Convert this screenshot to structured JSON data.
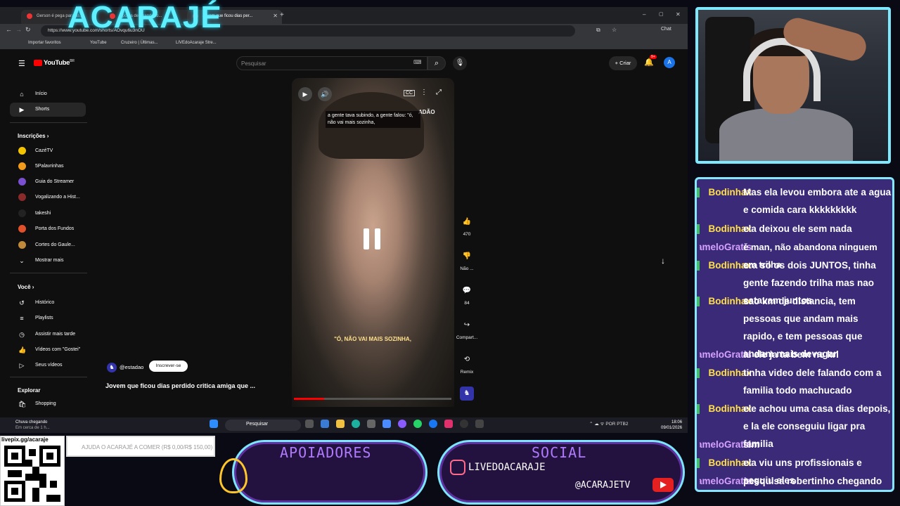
{
  "overlay": {
    "channel_title": "ACARAJÉ",
    "qr_label": "livepix.gg/acaraje",
    "goal_text": "AJUDA O ACARAJÉ A COMER (R$ 0,00/R$ 150,00)",
    "supporters_title": "APOIADORES",
    "social_title": "SOCIAL",
    "instagram": "LIVEDOACARAJE",
    "youtube": "@ACARAJETV"
  },
  "browser": {
    "tabs": [
      {
        "label": "Gerson é pega para as..."
      },
      {
        "label": "Aposta de abandono..."
      },
      {
        "label": "Jovem que ficou dias per..."
      }
    ],
    "url": "https://www.youtube.com/shorts/AOvqu6u3nOU",
    "bookmarks": [
      {
        "label": "Importar favoritos"
      },
      {
        "label": "YouTube"
      },
      {
        "label": "Cruzeiro | Últimas..."
      },
      {
        "label": "LIVEdoAcaraje Stre..."
      }
    ],
    "profile_label": "Chat"
  },
  "youtube": {
    "logo": "YouTube",
    "country": "BR",
    "search_placeholder": "Pesquisar",
    "create_label": "Criar",
    "notifications_badge": "9+",
    "avatar_letter": "A",
    "nav": [
      {
        "label": "Início",
        "icon": "home-icon"
      },
      {
        "label": "Shorts",
        "icon": "shorts-icon"
      }
    ],
    "subscriptions_header": "Inscrições",
    "subscriptions": [
      {
        "label": "CazéTV",
        "color": "#f5c400"
      },
      {
        "label": "5Palavrinhas",
        "color": "#f29a1a"
      },
      {
        "label": "Guia do Streamer",
        "color": "#7a4fd0"
      },
      {
        "label": "Vogalizando a Hist...",
        "color": "#8a2a2a"
      },
      {
        "label": "takeshi",
        "color": "#222222"
      },
      {
        "label": "Porta dos Fundos",
        "color": "#e0502a"
      },
      {
        "label": "Cortes do Gaule...",
        "color": "#c08a3a"
      }
    ],
    "show_more": "Mostrar mais",
    "you_header": "Você",
    "you_items": [
      {
        "label": "Histórico",
        "icon": "history-icon"
      },
      {
        "label": "Playlists",
        "icon": "playlist-icon"
      },
      {
        "label": "Assistir mais tarde",
        "icon": "watch-later-icon"
      },
      {
        "label": "Vídeos com \"Gostei\"",
        "icon": "thumbs-up-icon"
      },
      {
        "label": "Seus vídeos",
        "icon": "video-icon"
      }
    ],
    "explore_header": "Explorar",
    "explore_items": [
      {
        "label": "Shopping",
        "icon": "shopping-icon"
      }
    ],
    "short": {
      "caption_top": "a gente tava subindo, a gente falou: \"ó, não vai mais sozinha,",
      "caption_bottom": "\"Ó, NÃO VAI MAIS SOZINHA,",
      "watermark": "ADÃO",
      "channel": "@estadao",
      "subscribe": "Inscrever-se",
      "title": "Jovem que ficou dias perdido critica amiga que ...",
      "progress": 0.19,
      "likes": "470",
      "dislike_label": "Não ...",
      "comments": "84",
      "share_label": "Compart...",
      "remix_label": "Remix"
    }
  },
  "taskbar": {
    "weather_title": "Chuva chegando",
    "weather_sub": "Em cerca de 1 h...",
    "search": "Pesquisar",
    "lang": "POR",
    "layout": "PTB2",
    "time": "18:06",
    "date": "09/01/2026"
  },
  "chat": [
    {
      "user": "Bodinhax",
      "text": "Mas ela levou embora ate a agua e comida cara kkkkkkkkk"
    },
    {
      "user": "Bodinhax",
      "text": "ela deixou ele sem nada"
    },
    {
      "user": "CameloGratis",
      "text": "é man, não abandona ninguem em trilha"
    },
    {
      "user": "Bodinhax",
      "text": "era so os dois JUNTOS, tinha gente fazendo trilha mas nao estavam juntos"
    },
    {
      "user": "Bodinhax",
      "text": "sao km de distancia, tem pessoas que andam mais rapido, e tem pessoas que andam mais devagar"
    },
    {
      "user": "CameloGratis",
      "text": "ai ele ja ta bem ne krl"
    },
    {
      "user": "Bodinhax",
      "text": "tinha video dele falando com a familia todo machucado"
    },
    {
      "user": "Bodinhax",
      "text": "ele achou uma casa dias depois, e la ele conseguiu ligar pra familia"
    },
    {
      "user": "CameloGratis",
      "text": "sim"
    },
    {
      "user": "Bodinhax",
      "text": "ela viu uns profissionais e seguiu eles"
    },
    {
      "user": "CameloGratis",
      "text": "pesquisa robertinho chegando da trilha"
    }
  ]
}
